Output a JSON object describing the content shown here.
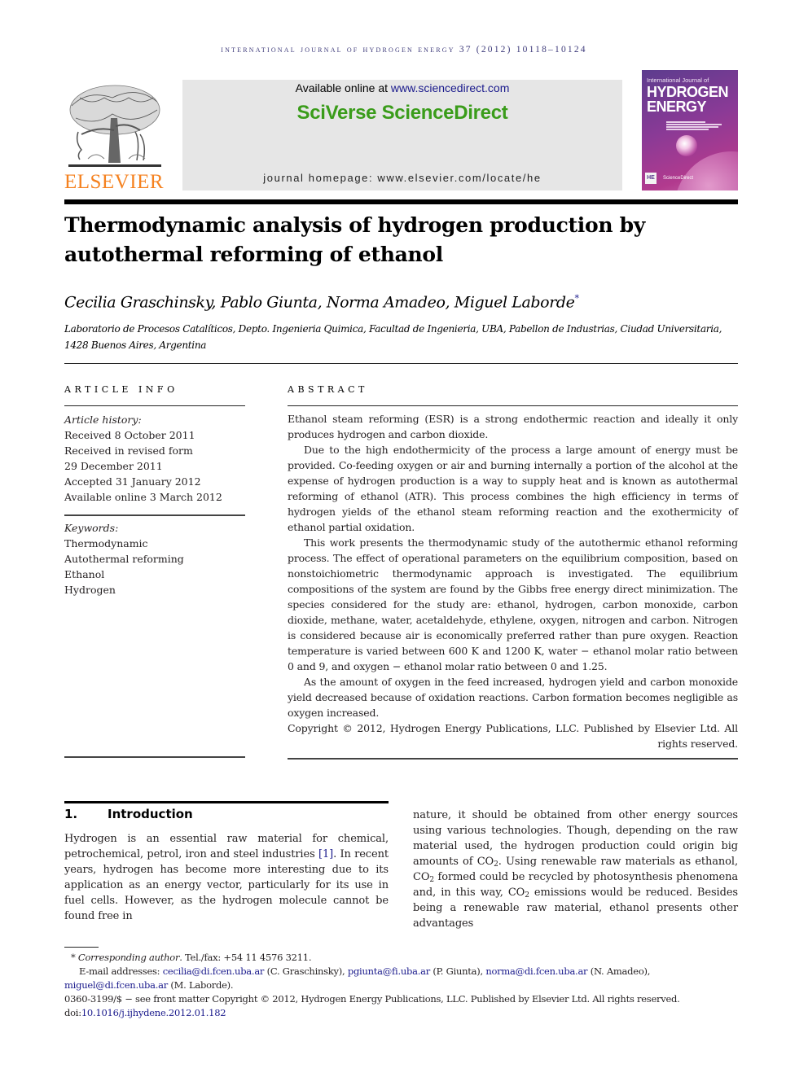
{
  "running_head": "International Journal of Hydrogen Energy 37 (2012) 10118–10124",
  "publisher": {
    "logo_icon": "elsevier-tree-icon",
    "name": "ELSEVIER"
  },
  "sciencedirect": {
    "available_prefix": "Available online at ",
    "available_link": "www.sciencedirect.com",
    "brand": "SciVerse ScienceDirect",
    "homepage": "journal homepage: www.elsevier.com/locate/he"
  },
  "journal_cover": {
    "top_line": "International Journal of",
    "title_line1": "HYDROGEN",
    "title_line2": "ENERGY",
    "badge": "HE",
    "footer": "ScienceDirect"
  },
  "article": {
    "title": "Thermodynamic analysis of hydrogen production by autothermal reforming of ethanol",
    "authors": "Cecilia Graschinsky, Pablo Giunta, Norma Amadeo, Miguel Laborde",
    "corresponding_mark": "*",
    "affiliation": "Laboratorio de Procesos Catalíticos, Depto. Ingenieria Quimica, Facultad de Ingenieria, UBA, Pabellon de Industrias, Ciudad Universitaria, 1428 Buenos Aires, Argentina"
  },
  "article_info": {
    "heading": "ARTICLE INFO",
    "history_label": "Article history:",
    "history": [
      "Received 8 October 2011",
      "Received in revised form",
      "29 December 2011",
      "Accepted 31 January 2012",
      "Available online 3 March 2012"
    ],
    "keywords_label": "Keywords:",
    "keywords": [
      "Thermodynamic",
      "Autothermal reforming",
      "Ethanol",
      "Hydrogen"
    ]
  },
  "abstract": {
    "heading": "ABSTRACT",
    "paragraphs": [
      "Ethanol steam reforming (ESR) is a strong endothermic reaction and ideally it only produces hydrogen and carbon dioxide.",
      "Due to the high endothermicity of the process a large amount of energy must be provided. Co-feeding oxygen or air and burning internally a portion of the alcohol at the expense of hydrogen production is a way to supply heat and is known as autothermal reforming of ethanol (ATR). This process combines the high efficiency in terms of hydrogen yields of the ethanol steam reforming reaction and the exothermicity of ethanol partial oxidation.",
      "This work presents the thermodynamic study of the autothermic ethanol reforming process. The effect of operational parameters on the equilibrium composition, based on nonstoichiometric thermodynamic approach is investigated. The equilibrium compositions of the system are found by the Gibbs free energy direct minimization. The species considered for the study are: ethanol, hydrogen, carbon monoxide, carbon dioxide, methane, water, acetaldehyde, ethylene, oxygen, nitrogen and carbon. Nitrogen is considered because air is economically preferred rather than pure oxygen. Reaction temperature is varied between 600 K and 1200 K, water − ethanol molar ratio between 0 and 9, and oxygen − ethanol molar ratio between 0 and 1.25.",
      "As the amount of oxygen in the feed increased, hydrogen yield and carbon monoxide yield decreased because of oxidation reactions. Carbon formation becomes negligible as oxygen increased."
    ],
    "copyright": "Copyright © 2012, Hydrogen Energy Publications, LLC. Published by Elsevier Ltd. All rights reserved."
  },
  "introduction": {
    "number": "1.",
    "heading": "Introduction",
    "left_p1": "Hydrogen is an essential raw material for chemical, petrochemical, petrol, iron and steel industries ",
    "left_cite": "[1]",
    "left_p2": ". In recent years, hydrogen has become more interesting due to its application as an energy vector, particularly for its use in fuel cells. However, as the hydrogen molecule cannot be found free in",
    "right_a": "nature, it should be obtained from other energy sources using various technologies. Though, depending on the raw material used, the hydrogen production could origin big amounts of CO",
    "right_b": ". Using renewable raw materials as ethanol, CO",
    "right_c": " formed could be recycled by photosynthesis phenomena and, in this way, CO",
    "right_d": " emissions would be reduced. Besides being a renewable raw material, ethanol presents other advantages",
    "subscript": "2"
  },
  "footnotes": {
    "corr_mark": "*",
    "corr_label": "Corresponding author",
    "corr_tel": ". Tel./fax: +54 11 4576 3211.",
    "email_label": "E-mail addresses: ",
    "emails": [
      {
        "address": "cecilia@di.fcen.uba.ar",
        "name": " (C. Graschinsky), "
      },
      {
        "address": "pgiunta@fi.uba.ar",
        "name": " (P. Giunta), "
      },
      {
        "address": "norma@di.fcen.uba.ar",
        "name": " (N. Amadeo), "
      },
      {
        "address": "miguel@di.fcen.uba.ar",
        "name": " (M. Laborde)."
      }
    ],
    "front_matter": "0360-3199/$ − see front matter Copyright © 2012, Hydrogen Energy Publications, LLC. Published by Elsevier Ltd. All rights reserved.",
    "doi_label": "doi:",
    "doi": "10.1016/j.ijhydene.2012.01.182"
  }
}
